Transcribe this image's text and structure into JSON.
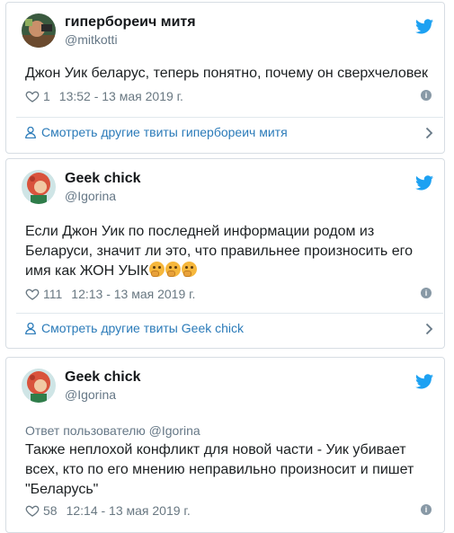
{
  "tweets": [
    {
      "name": "гиперборeич митя",
      "handle": "@mitkotti",
      "text": "Джон Уик беларус, теперь понятно, почему он сверхчеловек",
      "likes": "1",
      "timestamp": "13:52 - 13 мая 2019 г.",
      "more_link": "Смотреть другие твиты гиперборeич митя"
    },
    {
      "name": "Geek chick",
      "handle": "@Igorina",
      "text": "Если Джон Уик по последней информации родом из Беларуси, значит ли это, что правильнее произносить его имя как ЖОН УЫК",
      "emoji": [
        "thinking-face-emoji",
        "thinking-face-emoji",
        "thinking-face-emoji"
      ],
      "likes": "111",
      "timestamp": "12:13 - 13 мая 2019 г.",
      "more_link": "Смотреть другие твиты Geek chick"
    },
    {
      "name": "Geek chick",
      "handle": "@Igorina",
      "reply_to": "Ответ пользователю @Igorina",
      "text": "Также неплохой конфликт для новой части - Уик убивает всех, кто по его мнению неправильно произносит и пишет \"Беларусь\"",
      "likes": "58",
      "timestamp": "12:14 - 13 мая 2019 г."
    }
  ],
  "colors": {
    "twitter_blue": "#1da1f2",
    "link_blue": "#2b7bb9",
    "meta_gray": "#697882",
    "border": "#d7dde3"
  },
  "icons": {
    "brand": "twitter-bird-icon",
    "like": "heart-icon",
    "info": "info-icon",
    "profile": "person-icon",
    "navigate": "chevron-right-icon"
  }
}
